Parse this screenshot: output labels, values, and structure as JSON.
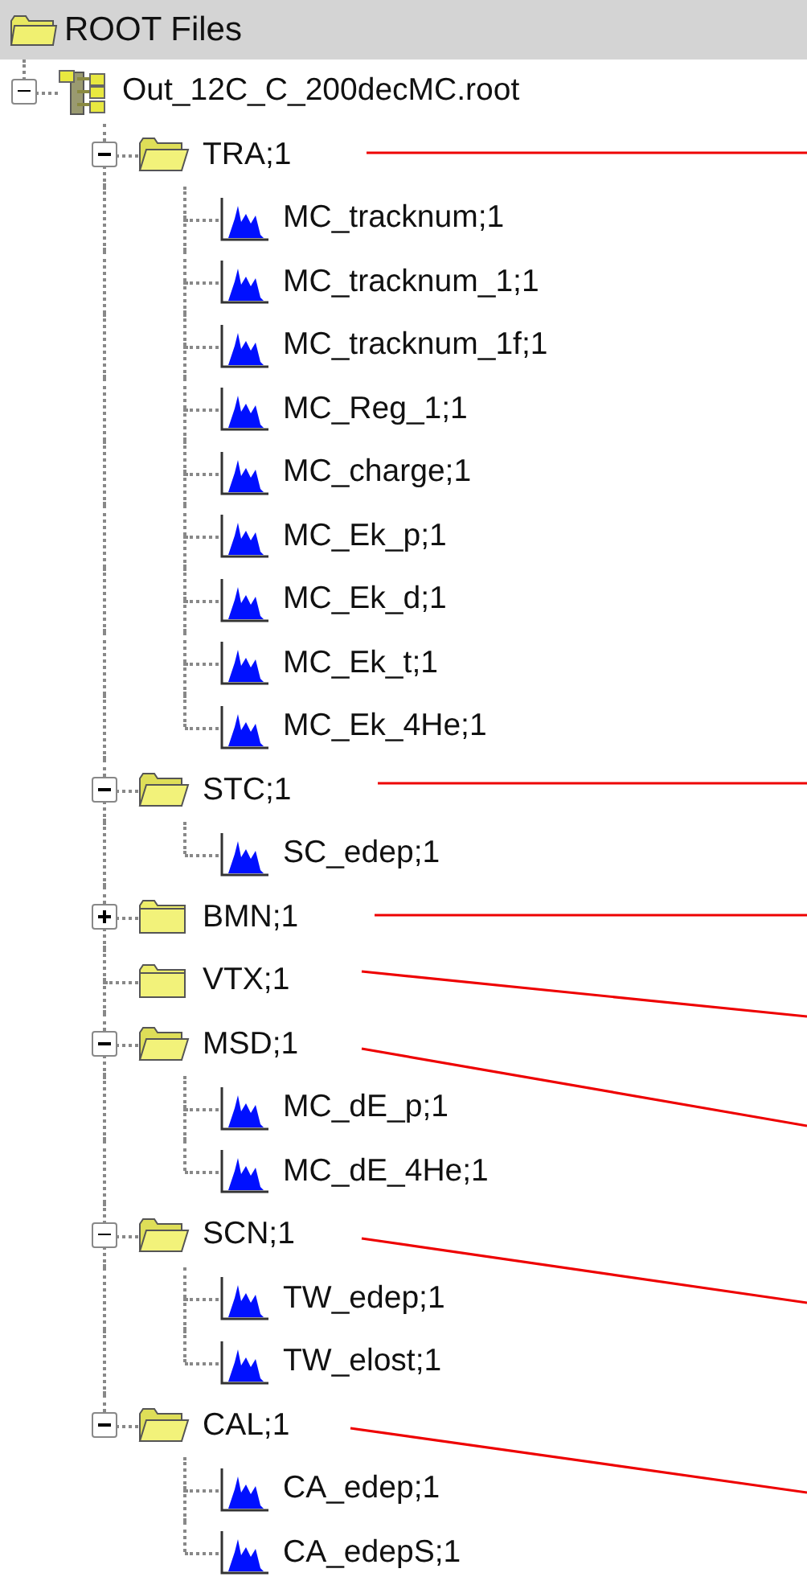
{
  "header": {
    "title": "ROOT Files"
  },
  "tree": [
    {
      "label": "Out_12C_C_200decMC.root",
      "kind": "file",
      "expanded": true,
      "children": [
        {
          "label": "TRA;1",
          "kind": "folder",
          "expanded": true,
          "children": [
            {
              "label": "MC_tracknum;1",
              "kind": "histogram"
            },
            {
              "label": "MC_tracknum_1;1",
              "kind": "histogram"
            },
            {
              "label": "MC_tracknum_1f;1",
              "kind": "histogram"
            },
            {
              "label": "MC_Reg_1;1",
              "kind": "histogram"
            },
            {
              "label": "MC_charge;1",
              "kind": "histogram"
            },
            {
              "label": "MC_Ek_p;1",
              "kind": "histogram"
            },
            {
              "label": "MC_Ek_d;1",
              "kind": "histogram"
            },
            {
              "label": "MC_Ek_t;1",
              "kind": "histogram"
            },
            {
              "label": "MC_Ek_4He;1",
              "kind": "histogram"
            }
          ]
        },
        {
          "label": "STC;1",
          "kind": "folder",
          "expanded": true,
          "children": [
            {
              "label": "SC_edep;1",
              "kind": "histogram"
            }
          ]
        },
        {
          "label": "BMN;1",
          "kind": "folder",
          "expanded": false
        },
        {
          "label": "VTX;1",
          "kind": "folder"
        },
        {
          "label": "MSD;1",
          "kind": "folder",
          "expanded": true,
          "children": [
            {
              "label": "MC_dE_p;1",
              "kind": "histogram"
            },
            {
              "label": "MC_dE_4He;1",
              "kind": "histogram"
            }
          ]
        },
        {
          "label": "SCN;1",
          "kind": "folder",
          "expanded": true,
          "children": [
            {
              "label": "TW_edep;1",
              "kind": "histogram"
            },
            {
              "label": "TW_elost;1",
              "kind": "histogram"
            }
          ]
        },
        {
          "label": "CAL;1",
          "kind": "folder",
          "expanded": true,
          "children": [
            {
              "label": "CA_edep;1",
              "kind": "histogram"
            },
            {
              "label": "CA_edepS;1",
              "kind": "histogram"
            }
          ]
        }
      ]
    }
  ]
}
